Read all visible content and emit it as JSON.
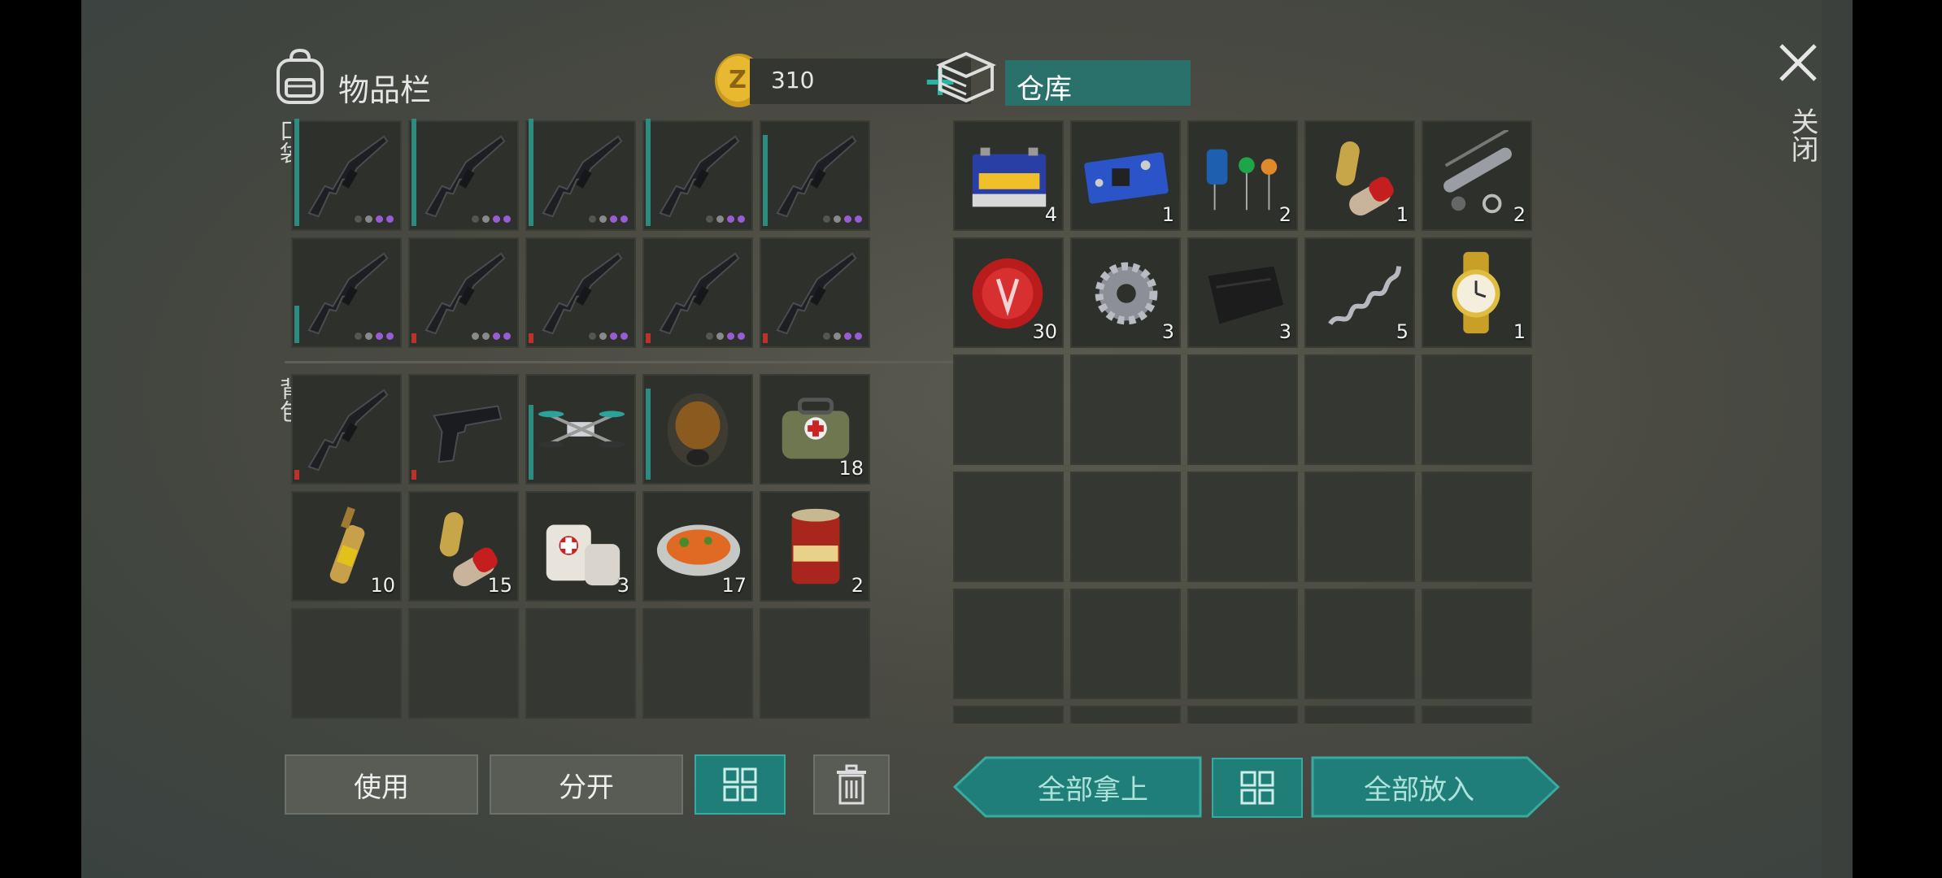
{
  "inventory": {
    "title": "物品栏",
    "coins": "310",
    "pocket_label": "口袋",
    "backpack_label": "背包"
  },
  "storage": {
    "title": "仓库"
  },
  "close_label": "关闭",
  "pocket_slots": [
    {
      "item": "assault-rifle",
      "durability": 1.0,
      "rarity_dots": [
        "g",
        "lg",
        "p",
        "p"
      ]
    },
    {
      "item": "assault-rifle",
      "durability": 1.0,
      "rarity_dots": [
        "g",
        "lg",
        "p",
        "p"
      ]
    },
    {
      "item": "assault-rifle",
      "durability": 1.0,
      "rarity_dots": [
        "g",
        "lg",
        "p",
        "p"
      ]
    },
    {
      "item": "assault-rifle",
      "durability": 1.0,
      "rarity_dots": [
        "g",
        "lg",
        "p",
        "p"
      ]
    },
    {
      "item": "assault-rifle",
      "durability": 0.85,
      "rarity_dots": [
        "g",
        "lg",
        "p",
        "p"
      ]
    },
    {
      "item": "assault-rifle",
      "durability": 0.35,
      "rarity_dots": [
        "g",
        "lg",
        "p",
        "p"
      ]
    },
    {
      "item": "assault-rifle",
      "durability": 0.1,
      "rarity_dots": [
        "lg",
        "lg",
        "p",
        "p"
      ]
    },
    {
      "item": "assault-rifle",
      "durability": 0.1,
      "rarity_dots": [
        "g",
        "lg",
        "p",
        "p"
      ]
    },
    {
      "item": "assault-rifle",
      "durability": 0.1,
      "rarity_dots": [
        "g",
        "lg",
        "p",
        "p"
      ]
    },
    {
      "item": "assault-rifle",
      "durability": 0.1,
      "rarity_dots": [
        "g",
        "lg",
        "p",
        "p"
      ]
    }
  ],
  "backpack_slots": [
    {
      "item": "assault-rifle",
      "count": "",
      "durability": 0.1
    },
    {
      "item": "pistol",
      "count": "",
      "durability": 0.1
    },
    {
      "item": "drone",
      "count": "",
      "durability": 0.7
    },
    {
      "item": "gas-mask",
      "count": "",
      "durability": 0.85
    },
    {
      "item": "medkit-bag",
      "count": "18"
    },
    {
      "item": "ampoule",
      "count": "10"
    },
    {
      "item": "pills",
      "count": "15"
    },
    {
      "item": "bandage",
      "count": "3"
    },
    {
      "item": "food-plate",
      "count": "17"
    },
    {
      "item": "food-can",
      "count": "2"
    }
  ],
  "storage_slots": [
    {
      "item": "battery",
      "count": "4"
    },
    {
      "item": "circuit-board",
      "count": "1"
    },
    {
      "item": "electronic-parts",
      "count": "2"
    },
    {
      "item": "pills",
      "count": "1"
    },
    {
      "item": "metal-parts",
      "count": "2"
    },
    {
      "item": "bottle-cap",
      "count": "30"
    },
    {
      "item": "gear",
      "count": "3"
    },
    {
      "item": "leather",
      "count": "3"
    },
    {
      "item": "spring",
      "count": "5"
    },
    {
      "item": "gold-watch",
      "count": "1"
    }
  ],
  "buttons": {
    "use": "使用",
    "split": "分开",
    "take_all": "全部拿上",
    "put_all": "全部放入"
  },
  "colors": {
    "accent": "#1f7f78",
    "durability": "#2f8a80",
    "durability_low": "#b8332a",
    "rarity_purple": "#9a5cd6"
  }
}
